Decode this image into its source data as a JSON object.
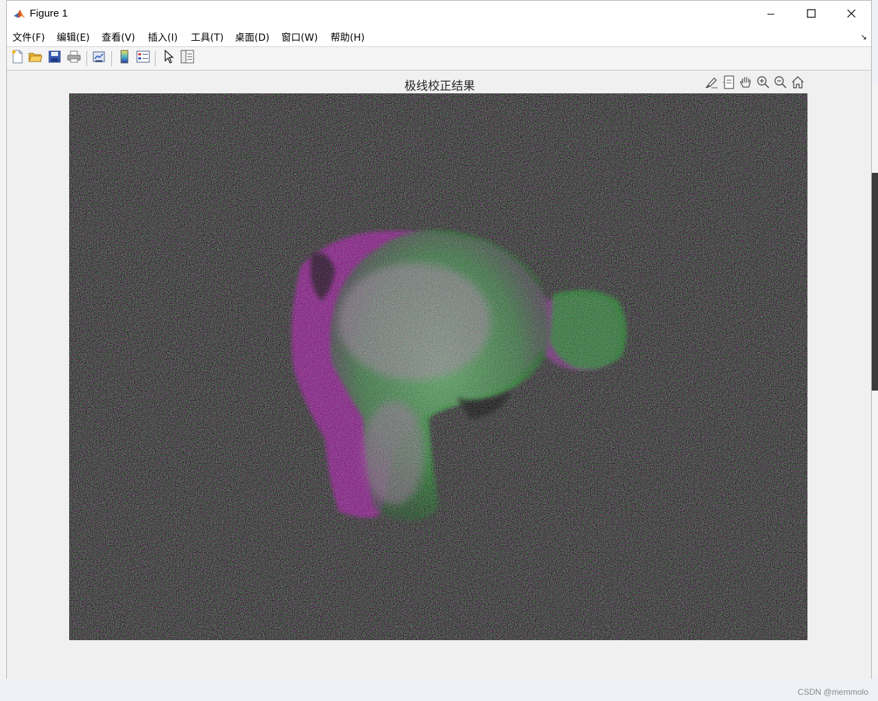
{
  "window": {
    "title": "Figure 1",
    "controls": [
      "minimize-icon",
      "maximize-icon",
      "close-icon"
    ]
  },
  "menu": {
    "items": [
      "文件(F)",
      "编辑(E)",
      "查看(V)",
      "插入(I)",
      "工具(T)",
      "桌面(D)",
      "窗口(W)",
      "帮助(H)"
    ]
  },
  "toolbar": {
    "buttons": [
      "new-figure-icon",
      "open-file-icon",
      "save-icon",
      "print-icon",
      "link-plot-icon",
      "colorbar-icon",
      "legend-icon",
      "edit-plot-icon",
      "property-inspector-icon"
    ]
  },
  "axes_toolbar": {
    "buttons": [
      "brush-icon",
      "data-tips-icon",
      "pan-icon",
      "zoom-in-icon",
      "zoom-out-icon",
      "home-icon"
    ]
  },
  "plot": {
    "title": "极线校正结果"
  },
  "colors": {
    "green_channel": "#2ee83a",
    "magenta_channel": "#c21fc2",
    "background": "#1d1d1d"
  },
  "watermark": "CSDN @memmolo"
}
